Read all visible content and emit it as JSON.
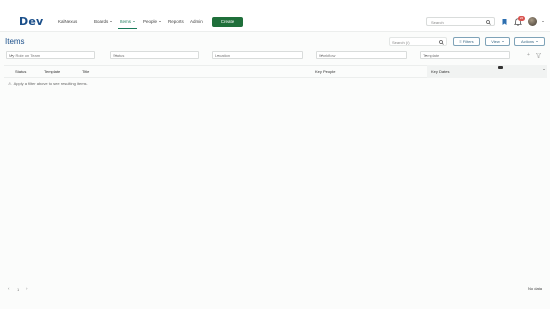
{
  "app": {
    "logo": "Dev",
    "org": "KalNexus"
  },
  "nav": {
    "items": [
      {
        "label": "Boards",
        "dropdown": true
      },
      {
        "label": "Items",
        "dropdown": true,
        "active": true
      },
      {
        "label": "People",
        "dropdown": true
      },
      {
        "label": "Reports",
        "dropdown": false
      },
      {
        "label": "Admin",
        "dropdown": false
      }
    ],
    "create_label": "Create",
    "search_placeholder": "Search",
    "notification_count": "22"
  },
  "page": {
    "title": "Items",
    "search_placeholder": "Search (/)",
    "filters_label": "Filters",
    "view_label": "View",
    "actions_label": "Actions"
  },
  "filters": [
    {
      "placeholder": "My Role on Team"
    },
    {
      "placeholder": "Status"
    },
    {
      "placeholder": "Location"
    },
    {
      "placeholder": "Workflow"
    },
    {
      "placeholder": "Template"
    }
  ],
  "table": {
    "columns": [
      "Status",
      "Template",
      "Title",
      "Key People",
      "Key Dates"
    ],
    "notice": "Apply a filter above to see resulting items."
  },
  "footer": {
    "page": "1",
    "status": "No data"
  },
  "colors": {
    "brand": "#1b4f8a",
    "accent": "#1a7a5a",
    "create": "#1f6f3a",
    "badge": "#d9534f"
  }
}
